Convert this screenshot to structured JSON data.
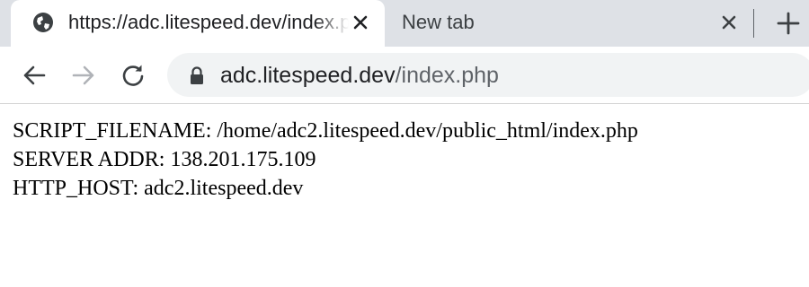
{
  "browser": {
    "tabs": [
      {
        "title": "https://adc.litespeed.dev/index.php",
        "active": true,
        "icon": "globe-icon"
      },
      {
        "title": "New tab",
        "active": false
      }
    ],
    "toolbar": {
      "url_host": "adc.litespeed.dev",
      "url_path": "/index.php",
      "security_icon": "lock-icon"
    },
    "colors": {
      "tabstrip_bg": "#dee1e6",
      "omnibox_bg": "#f1f3f4",
      "icon_color": "#5f6368"
    }
  },
  "page": {
    "lines": [
      "SCRIPT_FILENAME: /home/adc2.litespeed.dev/public_html/index.php",
      "SERVER ADDR: 138.201.175.109",
      "HTTP_HOST: adc2.litespeed.dev"
    ]
  }
}
